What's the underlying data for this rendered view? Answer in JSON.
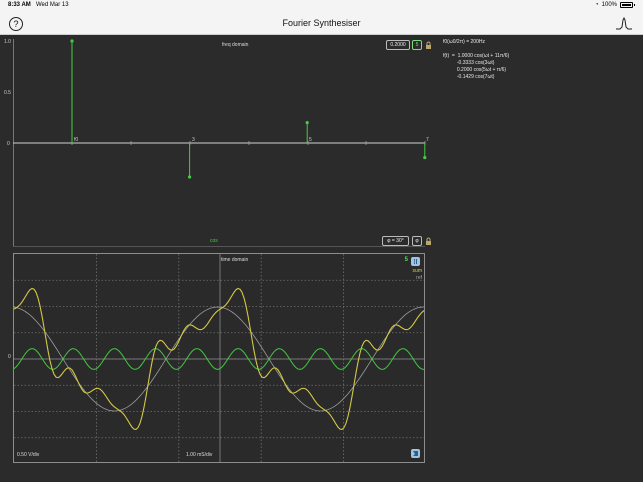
{
  "status": {
    "time": "8:33 AM",
    "date": "Wed Mar 13",
    "battery": "100%"
  },
  "nav": {
    "title": "Fourier Synthesiser",
    "help_label": "?"
  },
  "frequency": {
    "title": "freq domain",
    "harmonic_value": "0.2000",
    "harmonic_count": "5",
    "wave_label": "cos",
    "phase_value": "φ = 30°",
    "y_ticks": [
      "1.0",
      "0.5",
      "0"
    ],
    "harmonic_labels": [
      "f0",
      "3",
      "5",
      "7"
    ],
    "points": [
      {
        "x": 1,
        "y": 1.0
      },
      {
        "x": 3,
        "y": -0.3333
      },
      {
        "x": 5,
        "y": 0.2
      },
      {
        "x": 7,
        "y": -0.1429
      }
    ],
    "colors": {
      "stem": "#44cc44",
      "axis": "#d0d0d0"
    }
  },
  "equation": {
    "fundamental": "f0(ω0/2π) = 200Hz",
    "lines": [
      "f(t)  =  1.0000 cos(ωt + 11π/6)",
      "          -0.3333 cos(3ωt)",
      "          0.2000 cos(5ωt + π/6)",
      "          -0.1429 cos(7ωt)"
    ]
  },
  "time": {
    "title": "time domain",
    "volts_div": "0.50 V/div",
    "time_div": "1.00 mS/div",
    "sum_label": "sum",
    "ref_label": "ref",
    "counter": "5",
    "zero_label": "0",
    "series": {
      "sum": {
        "color": "#d4c843",
        "harmonics": [
          1,
          3,
          5,
          7
        ],
        "amplitudes": [
          1.0,
          -0.3333,
          0.2,
          -0.1429
        ],
        "phases_deg": [
          330,
          0,
          30,
          0
        ]
      },
      "ref": {
        "color": "#9c9c9c",
        "harmonics": [
          1
        ],
        "amplitudes": [
          1.0
        ],
        "phases_deg": [
          330
        ]
      },
      "current": {
        "color": "#43c743",
        "harmonics": [
          5
        ],
        "amplitudes": [
          0.2
        ],
        "phases_deg": [
          30
        ]
      }
    }
  }
}
